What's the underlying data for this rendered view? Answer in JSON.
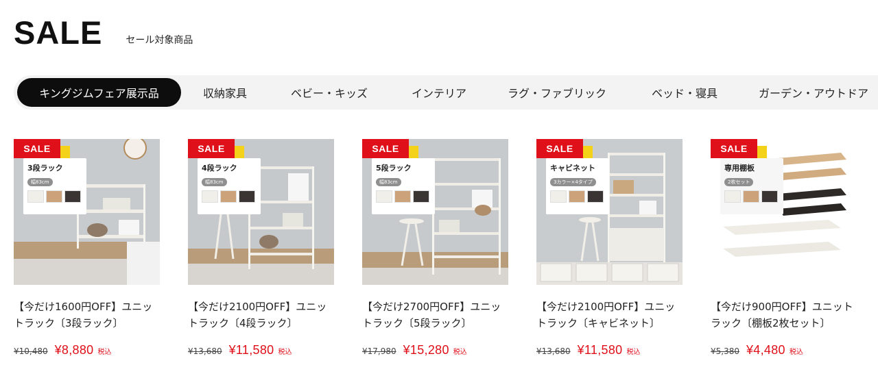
{
  "header": {
    "title": "SALE",
    "subtitle": "セール対象商品"
  },
  "tabs": [
    {
      "label": "キングジムフェア展示品",
      "active": true
    },
    {
      "label": "収納家具",
      "active": false
    },
    {
      "label": "ベビー・キッズ",
      "active": false
    },
    {
      "label": "インテリア",
      "active": false
    },
    {
      "label": "ラグ・ファブリック",
      "active": false
    },
    {
      "label": "ベッド・寝具",
      "active": false
    },
    {
      "label": "ガーデン・アウトドア",
      "active": false
    }
  ],
  "badge_label": "SALE",
  "colors": {
    "accent": "#e0101a",
    "tab_active_bg": "#0d0d0d",
    "tabs_bg": "#f3f3f3"
  },
  "products": [
    {
      "image_label": "3段ラック",
      "image_sub": "幅83cm",
      "name": "【今だけ1600円OFF】ユニットラック〔3段ラック〕",
      "original_price": "¥10,480",
      "sale_price": "¥8,880",
      "tax_label": "税込"
    },
    {
      "image_label": "4段ラック",
      "image_sub": "幅83cm",
      "name": "【今だけ2100円OFF】ユニットラック〔4段ラック〕",
      "original_price": "¥13,680",
      "sale_price": "¥11,580",
      "tax_label": "税込"
    },
    {
      "image_label": "5段ラック",
      "image_sub": "幅83cm",
      "name": "【今だけ2700円OFF】ユニットラック〔5段ラック〕",
      "original_price": "¥17,980",
      "sale_price": "¥15,280",
      "tax_label": "税込"
    },
    {
      "image_label": "キャビネット",
      "image_sub": "3カラー×4タイプ",
      "name": "【今だけ2100円OFF】ユニットラック〔キャビネット〕",
      "original_price": "¥13,680",
      "sale_price": "¥11,580",
      "tax_label": "税込"
    },
    {
      "image_label": "専用棚板",
      "image_sub": "2枚セット",
      "name": "【今だけ900円OFF】ユニットラック〔棚板2枚セット〕",
      "original_price": "¥5,380",
      "sale_price": "¥4,480",
      "tax_label": "税込"
    }
  ]
}
